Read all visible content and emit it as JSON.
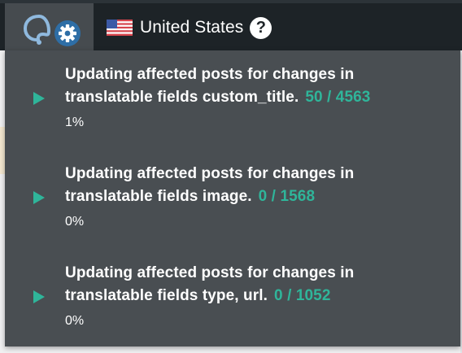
{
  "topbar": {
    "country_name": "United States",
    "help_symbol": "?",
    "icons": [
      "plugin-logo-icon",
      "gear-icon",
      "us-flag-icon",
      "help-icon"
    ],
    "colors": {
      "bar": "#1d2327",
      "active_tab": "#464b4f",
      "accent": "#2fb59a"
    }
  },
  "tasks": [
    {
      "line1": "Updating affected posts for changes in",
      "line2": "translatable fields custom_title.",
      "count": "50 / 4563",
      "percent": "1%",
      "icon": "play-icon"
    },
    {
      "line1": "Updating affected posts for changes in",
      "line2": "translatable fields image.",
      "count": "0 / 1568",
      "percent": "0%",
      "icon": "play-icon"
    },
    {
      "line1": "Updating affected posts for changes in",
      "line2": "translatable fields type, url.",
      "count": "0 / 1052",
      "percent": "0%",
      "icon": "play-icon"
    }
  ]
}
